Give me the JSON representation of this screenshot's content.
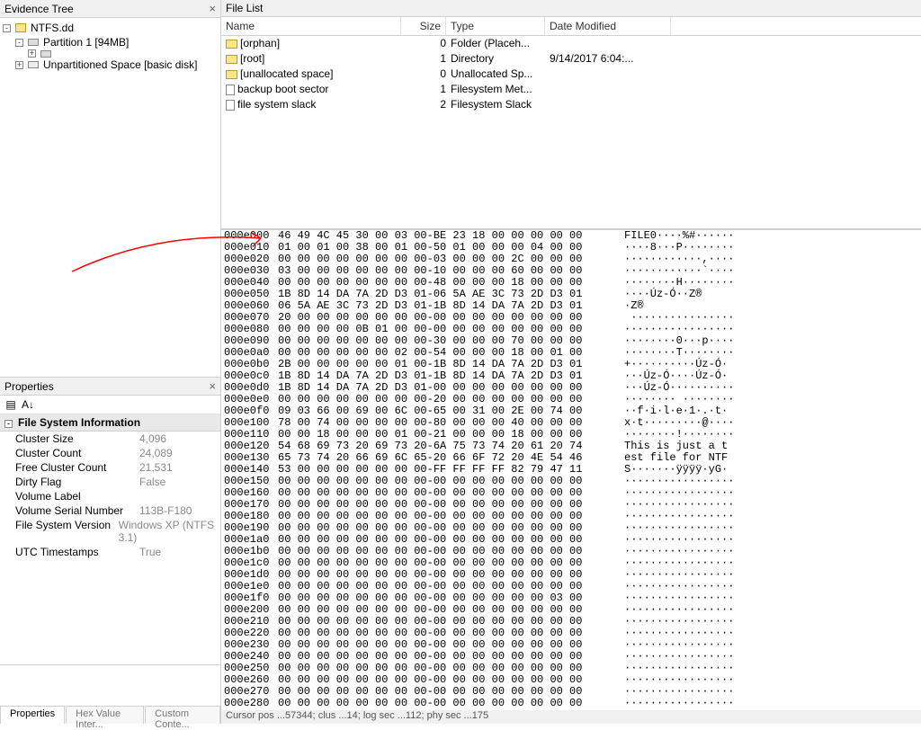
{
  "titles": {
    "evidence_tree": "Evidence Tree",
    "file_list": "File List",
    "properties": "Properties"
  },
  "tree": {
    "root": "NTFS.dd",
    "partition": "Partition 1 [94MB]",
    "unpart": "Unpartitioned Space [basic disk]"
  },
  "filelist": {
    "headers": {
      "name": "Name",
      "size": "Size",
      "type": "Type",
      "date": "Date Modified"
    },
    "rows": [
      {
        "name": "[orphan]",
        "icon": "folder",
        "size": "0",
        "type": "Folder (Placeh...",
        "date": ""
      },
      {
        "name": "[root]",
        "icon": "folder",
        "size": "1",
        "type": "Directory",
        "date": "9/14/2017 6:04:..."
      },
      {
        "name": "[unallocated space]",
        "icon": "folder",
        "size": "0",
        "type": "Unallocated Sp...",
        "date": ""
      },
      {
        "name": "backup boot sector",
        "icon": "file",
        "size": "1",
        "type": "Filesystem Met...",
        "date": ""
      },
      {
        "name": "file system slack",
        "icon": "file",
        "size": "2",
        "type": "Filesystem Slack",
        "date": ""
      }
    ]
  },
  "props": {
    "section": "File System Information",
    "rows": [
      {
        "k": "Cluster Size",
        "v": "4,096"
      },
      {
        "k": "Cluster Count",
        "v": "24,089"
      },
      {
        "k": "Free Cluster Count",
        "v": "21,531"
      },
      {
        "k": "Dirty Flag",
        "v": "False"
      },
      {
        "k": "Volume Label",
        "v": ""
      },
      {
        "k": "Volume Serial Number",
        "v": "113B-F180"
      },
      {
        "k": "File System Version",
        "v": "Windows XP (NTFS 3.1)"
      },
      {
        "k": "UTC Timestamps",
        "v": "True"
      }
    ]
  },
  "tabs": {
    "properties": "Properties",
    "hex": "Hex Value Inter...",
    "custom": "Custom Conte..."
  },
  "statusbar": "Cursor pos ...57344; clus ...14; log sec ...112; phy sec ...175",
  "hex": [
    {
      "o": "000e000",
      "b": "46 49 4C 45 30 00 03 00-BE 23 18 00 00 00 00 00",
      "a": "FILE0····%#······"
    },
    {
      "o": "000e010",
      "b": "01 00 01 00 38 00 01 00-50 01 00 00 00 04 00 00",
      "a": "····8···P········"
    },
    {
      "o": "000e020",
      "b": "00 00 00 00 00 00 00 00-03 00 00 00 2C 00 00 00",
      "a": "············,····"
    },
    {
      "o": "000e030",
      "b": "03 00 00 00 00 00 00 00-10 00 00 00 60 00 00 00",
      "a": "············`····"
    },
    {
      "o": "000e040",
      "b": "00 00 00 00 00 00 00 00-48 00 00 00 18 00 00 00",
      "a": "········H········"
    },
    {
      "o": "000e050",
      "b": "1B 8D 14 DA 7A 2D D3 01-06 5A AE 3C 73 2D D3 01",
      "a": "····Úz-Ó··Z®<s-Ó·"
    },
    {
      "o": "000e060",
      "b": "06 5A AE 3C 73 2D D3 01-1B 8D 14 DA 7A 2D D3 01",
      "a": "·Z®<s-Ó····Úz-Ó·"
    },
    {
      "o": "000e070",
      "b": "20 00 00 00 00 00 00 00-00 00 00 00 00 00 00 00",
      "a": " ················"
    },
    {
      "o": "000e080",
      "b": "00 00 00 00 0B 01 00 00-00 00 00 00 00 00 00 00",
      "a": "·················"
    },
    {
      "o": "000e090",
      "b": "00 00 00 00 00 00 00 00-30 00 00 00 70 00 00 00",
      "a": "········0···p····"
    },
    {
      "o": "000e0a0",
      "b": "00 00 00 00 00 00 02 00-54 00 00 00 18 00 01 00",
      "a": "········T········"
    },
    {
      "o": "000e0b0",
      "b": "2B 00 00 00 00 00 01 00-1B 8D 14 DA 7A 2D D3 01",
      "a": "+··········Úz-Ó·"
    },
    {
      "o": "000e0c0",
      "b": "1B 8D 14 DA 7A 2D D3 01-1B 8D 14 DA 7A 2D D3 01",
      "a": "···Úz-Ó····Úz-Ó·"
    },
    {
      "o": "000e0d0",
      "b": "1B 8D 14 DA 7A 2D D3 01-00 00 00 00 00 00 00 00",
      "a": "···Úz-Ó··········"
    },
    {
      "o": "000e0e0",
      "b": "00 00 00 00 00 00 00 00-20 00 00 00 00 00 00 00",
      "a": "········ ········"
    },
    {
      "o": "000e0f0",
      "b": "09 03 66 00 69 00 6C 00-65 00 31 00 2E 00 74 00",
      "a": "··f·i·l·e·1·.·t·"
    },
    {
      "o": "000e100",
      "b": "78 00 74 00 00 00 00 00-80 00 00 00 40 00 00 00",
      "a": "x·t·········@····"
    },
    {
      "o": "000e110",
      "b": "00 00 18 00 00 00 01 00-21 00 00 00 18 00 00 00",
      "a": "········!········"
    },
    {
      "o": "000e120",
      "b": "54 68 69 73 20 69 73 20-6A 75 73 74 20 61 20 74",
      "a": "This is just a t"
    },
    {
      "o": "000e130",
      "b": "65 73 74 20 66 69 6C 65-20 66 6F 72 20 4E 54 46",
      "a": "est file for NTF"
    },
    {
      "o": "000e140",
      "b": "53 00 00 00 00 00 00 00-FF FF FF FF 82 79 47 11",
      "a": "S·······ÿÿÿÿ·yG·"
    },
    {
      "o": "000e150",
      "b": "00 00 00 00 00 00 00 00-00 00 00 00 00 00 00 00",
      "a": "·················"
    },
    {
      "o": "000e160",
      "b": "00 00 00 00 00 00 00 00-00 00 00 00 00 00 00 00",
      "a": "·················"
    },
    {
      "o": "000e170",
      "b": "00 00 00 00 00 00 00 00-00 00 00 00 00 00 00 00",
      "a": "·················"
    },
    {
      "o": "000e180",
      "b": "00 00 00 00 00 00 00 00-00 00 00 00 00 00 00 00",
      "a": "·················"
    },
    {
      "o": "000e190",
      "b": "00 00 00 00 00 00 00 00-00 00 00 00 00 00 00 00",
      "a": "·················"
    },
    {
      "o": "000e1a0",
      "b": "00 00 00 00 00 00 00 00-00 00 00 00 00 00 00 00",
      "a": "·················"
    },
    {
      "o": "000e1b0",
      "b": "00 00 00 00 00 00 00 00-00 00 00 00 00 00 00 00",
      "a": "·················"
    },
    {
      "o": "000e1c0",
      "b": "00 00 00 00 00 00 00 00-00 00 00 00 00 00 00 00",
      "a": "·················"
    },
    {
      "o": "000e1d0",
      "b": "00 00 00 00 00 00 00 00-00 00 00 00 00 00 00 00",
      "a": "·················"
    },
    {
      "o": "000e1e0",
      "b": "00 00 00 00 00 00 00 00-00 00 00 00 00 00 00 00",
      "a": "·················"
    },
    {
      "o": "000e1f0",
      "b": "00 00 00 00 00 00 00 00-00 00 00 00 00 00 03 00",
      "a": "·················"
    },
    {
      "o": "000e200",
      "b": "00 00 00 00 00 00 00 00-00 00 00 00 00 00 00 00",
      "a": "·················"
    },
    {
      "o": "000e210",
      "b": "00 00 00 00 00 00 00 00-00 00 00 00 00 00 00 00",
      "a": "·················"
    },
    {
      "o": "000e220",
      "b": "00 00 00 00 00 00 00 00-00 00 00 00 00 00 00 00",
      "a": "·················"
    },
    {
      "o": "000e230",
      "b": "00 00 00 00 00 00 00 00-00 00 00 00 00 00 00 00",
      "a": "·················"
    },
    {
      "o": "000e240",
      "b": "00 00 00 00 00 00 00 00-00 00 00 00 00 00 00 00",
      "a": "·················"
    },
    {
      "o": "000e250",
      "b": "00 00 00 00 00 00 00 00-00 00 00 00 00 00 00 00",
      "a": "·················"
    },
    {
      "o": "000e260",
      "b": "00 00 00 00 00 00 00 00-00 00 00 00 00 00 00 00",
      "a": "·················"
    },
    {
      "o": "000e270",
      "b": "00 00 00 00 00 00 00 00-00 00 00 00 00 00 00 00",
      "a": "·················"
    },
    {
      "o": "000e280",
      "b": "00 00 00 00 00 00 00 00-00 00 00 00 00 00 00 00",
      "a": "·················"
    }
  ]
}
